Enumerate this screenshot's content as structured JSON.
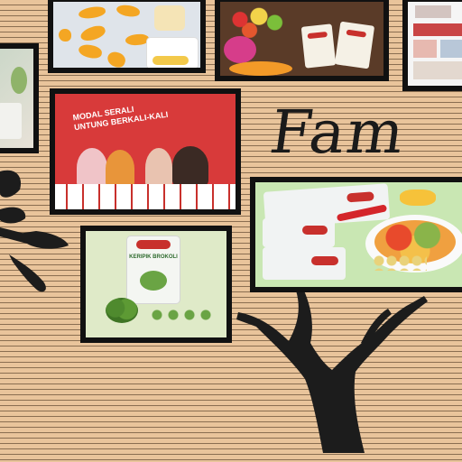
{
  "wall_text": "Fam",
  "photos": {
    "mango_chips": {
      "scene": "dried mango chips on a grey surface"
    },
    "fruit_tray": {
      "scene": "assorted fruits on a wooden table with product bags"
    },
    "left_partial": {
      "scene": "partially visible product photo"
    },
    "right_collage": {
      "scene": "collage of small product photos"
    },
    "team_banner": {
      "banner_text": "MODAL SERALI\nUNTUNG BERKALI-KALI",
      "scene": "group of women with product bags"
    },
    "snack_platter": {
      "scene": "plate of fruit and vegetable chips with chili and product packs"
    },
    "broccoli_pack": {
      "package_text": "KERIPIK BROKOLI",
      "scene": "broccoli chips package with fresh broccoli"
    }
  },
  "colors": {
    "wall": "#e9c49b",
    "stripe": "#3c2814",
    "frame": "#111111",
    "tree": "#1c1c1c",
    "banner_red": "#d83a3a"
  }
}
